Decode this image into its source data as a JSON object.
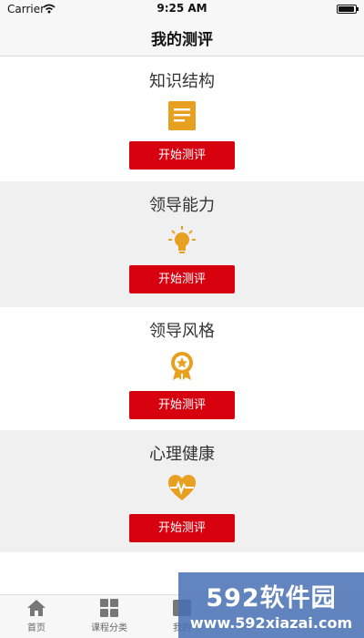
{
  "status_bar": {
    "carrier": "Carrier",
    "time": "9:25 AM"
  },
  "nav": {
    "title": "我的测评"
  },
  "sections": [
    {
      "title": "知识结构",
      "icon": "document-icon",
      "button": "开始测评"
    },
    {
      "title": "领导能力",
      "icon": "lightbulb-icon",
      "button": "开始测评"
    },
    {
      "title": "领导风格",
      "icon": "medal-icon",
      "button": "开始测评"
    },
    {
      "title": "心理健康",
      "icon": "heartbeat-icon",
      "button": "开始测评"
    }
  ],
  "tabs": [
    {
      "label": "首页",
      "icon": "home-icon"
    },
    {
      "label": "课程分类",
      "icon": "grid-icon"
    },
    {
      "label": "我的",
      "icon": "profile-icon"
    }
  ],
  "watermark": {
    "brand": "592软件园",
    "url": "www.592xiazai.com"
  },
  "colors": {
    "accent": "#d6000f",
    "icon": "#e8a020",
    "section_gray": "#f0f0f0"
  }
}
